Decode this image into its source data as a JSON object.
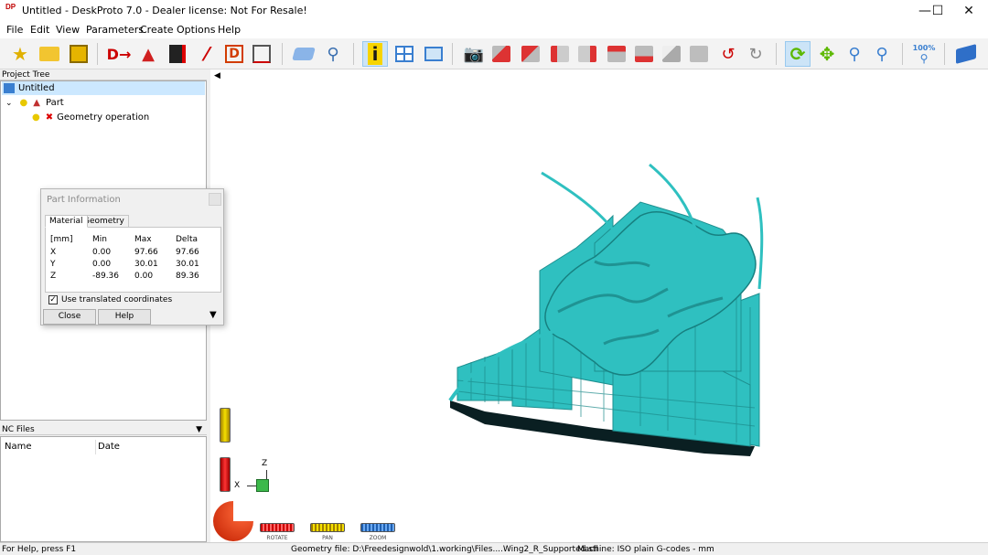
{
  "window": {
    "title": "Untitled - DeskProto 7.0 - Dealer license: Not For Resale!",
    "app_icon_text": "DP"
  },
  "menu": [
    "File",
    "Edit",
    "View",
    "Parameters",
    "Create",
    "Options",
    "Help"
  ],
  "toolbar": {
    "zoom_label": "100%"
  },
  "project_tree": {
    "header": "Project Tree",
    "items": [
      {
        "label": "Untitled"
      },
      {
        "label": "Part"
      },
      {
        "label": "Geometry operation"
      }
    ]
  },
  "nc_files": {
    "header": "NC Files",
    "columns": [
      "Name",
      "Date"
    ]
  },
  "part_info": {
    "title": "Part Information",
    "tabs": [
      "Material",
      "Geometry"
    ],
    "headers": [
      "[mm]",
      "Min",
      "Max",
      "Delta"
    ],
    "rows": [
      {
        "axis": "X",
        "min": "0.00",
        "max": "97.66",
        "delta": "97.66"
      },
      {
        "axis": "Y",
        "min": "0.00",
        "max": "30.01",
        "delta": "30.01"
      },
      {
        "axis": "Z",
        "min": "-89.36",
        "max": "0.00",
        "delta": "89.36"
      }
    ],
    "checkbox_label": "Use translated coordinates",
    "close_label": "Close",
    "help_label": "Help"
  },
  "viewport": {
    "axis_x": "X",
    "axis_z": "Z",
    "controls": [
      "ROTATE",
      "PAN",
      "ZOOM"
    ],
    "model_color": "#2fc0c0"
  },
  "status": {
    "help": "For Help, press F1",
    "geometry": "Geometry file: D:\\Freedesignwold\\1.working\\Files....Wing2_R_Supported.stl",
    "machine": "Machine: ISO plain G-codes - mm"
  }
}
